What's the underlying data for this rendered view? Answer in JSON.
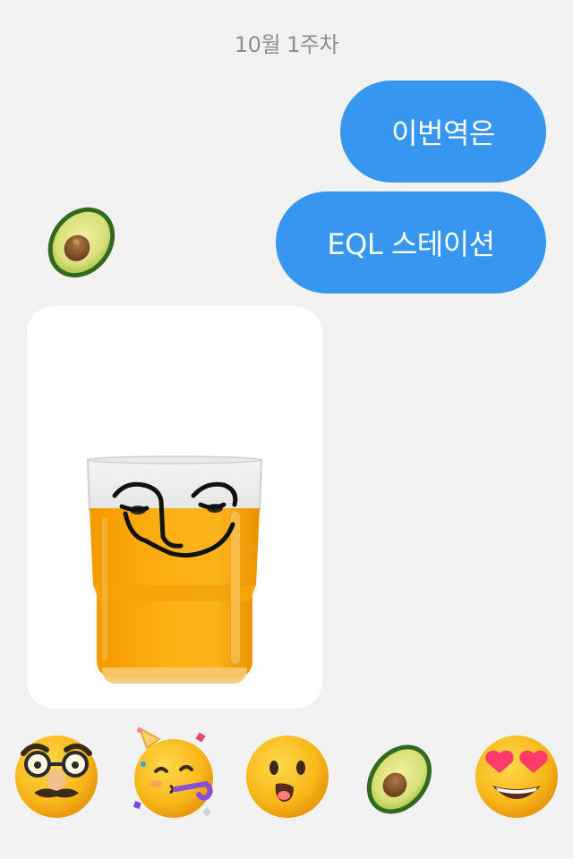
{
  "chat": {
    "date_label": "10월 1주차",
    "messages": [
      {
        "text": "이번역은",
        "sender": "me"
      },
      {
        "text": "EQL 스테이션",
        "sender": "me"
      }
    ],
    "sender_avatar_icon": "avocado-sticker",
    "received_image": {
      "subject": "glass-of-orange-juice-with-face-drawing",
      "background": "#ffffff"
    }
  },
  "reactions": [
    {
      "icon": "disguise-face-icon",
      "emoji": "🥸"
    },
    {
      "icon": "partying-face-icon",
      "emoji": "🥳"
    },
    {
      "icon": "surprised-face-icon",
      "emoji": "😮"
    },
    {
      "icon": "avocado-icon",
      "emoji": "🥑"
    },
    {
      "icon": "heart-eyes-face-icon",
      "emoji": "😍"
    }
  ],
  "colors": {
    "background": "#f2f2f2",
    "bubble": "#3797f0",
    "bubble_text": "#ffffff",
    "date_text": "#8e8e8e",
    "emoji_yellow": "#f9b81a",
    "juice": "#f8a407"
  }
}
